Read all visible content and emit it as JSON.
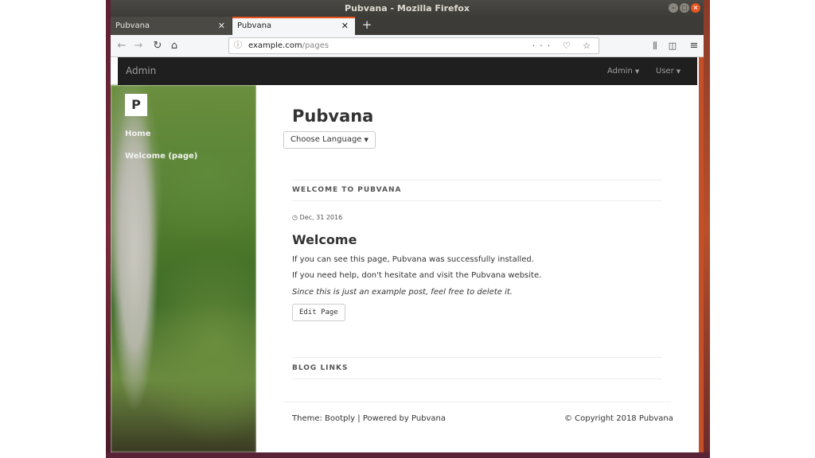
{
  "window": {
    "title": "Pubvana - Mozilla Firefox",
    "controls": {
      "minimize": "–",
      "maximize": "□",
      "close": "×"
    }
  },
  "tabs": [
    {
      "label": "Pubvana",
      "close": "✕",
      "active": false
    },
    {
      "label": "Pubvana",
      "close": "✕",
      "active": true
    }
  ],
  "new_tab": "+",
  "toolbar": {
    "back_icon": "arrow-left-icon",
    "forward_icon": "arrow-right-icon",
    "reload_icon": "reload-icon",
    "home_icon": "home-icon",
    "url_host": "example.com",
    "url_path": "/pages",
    "page_actions": "··· ♡ ☆",
    "library_icon": "library-icon",
    "sidebar_icon": "sidebar-icon",
    "menu_icon": "hamburger-menu-icon"
  },
  "admin_bar": {
    "brand": "Admin",
    "menus": [
      {
        "label": "Admin"
      },
      {
        "label": "User"
      }
    ]
  },
  "sidebar": {
    "logo": "P",
    "items": [
      {
        "label": "Home"
      },
      {
        "label": "Welcome (page)"
      }
    ]
  },
  "main": {
    "site_title": "Pubvana",
    "language_button": "Choose Language",
    "section_heading": "WELCOME TO PUBVANA",
    "post": {
      "date": "Dec, 31 2016",
      "title": "Welcome",
      "paragraphs": [
        "If you can see this page, Pubvana was successfully installed.",
        "If you need help, don't hesitate and visit the Pubvana website.",
        "Since this is just an example post, feel free to delete it."
      ],
      "edit_button": "Edit Page"
    },
    "blog_links_heading": "BLOG LINKS",
    "footer": {
      "left": "Theme: Bootply | Powered by Pubvana",
      "right": "© Copyright 2018 Pubvana"
    }
  },
  "colors": {
    "accent": "#e95420",
    "admin_bar": "#1f1f1f",
    "text": "#333333"
  }
}
